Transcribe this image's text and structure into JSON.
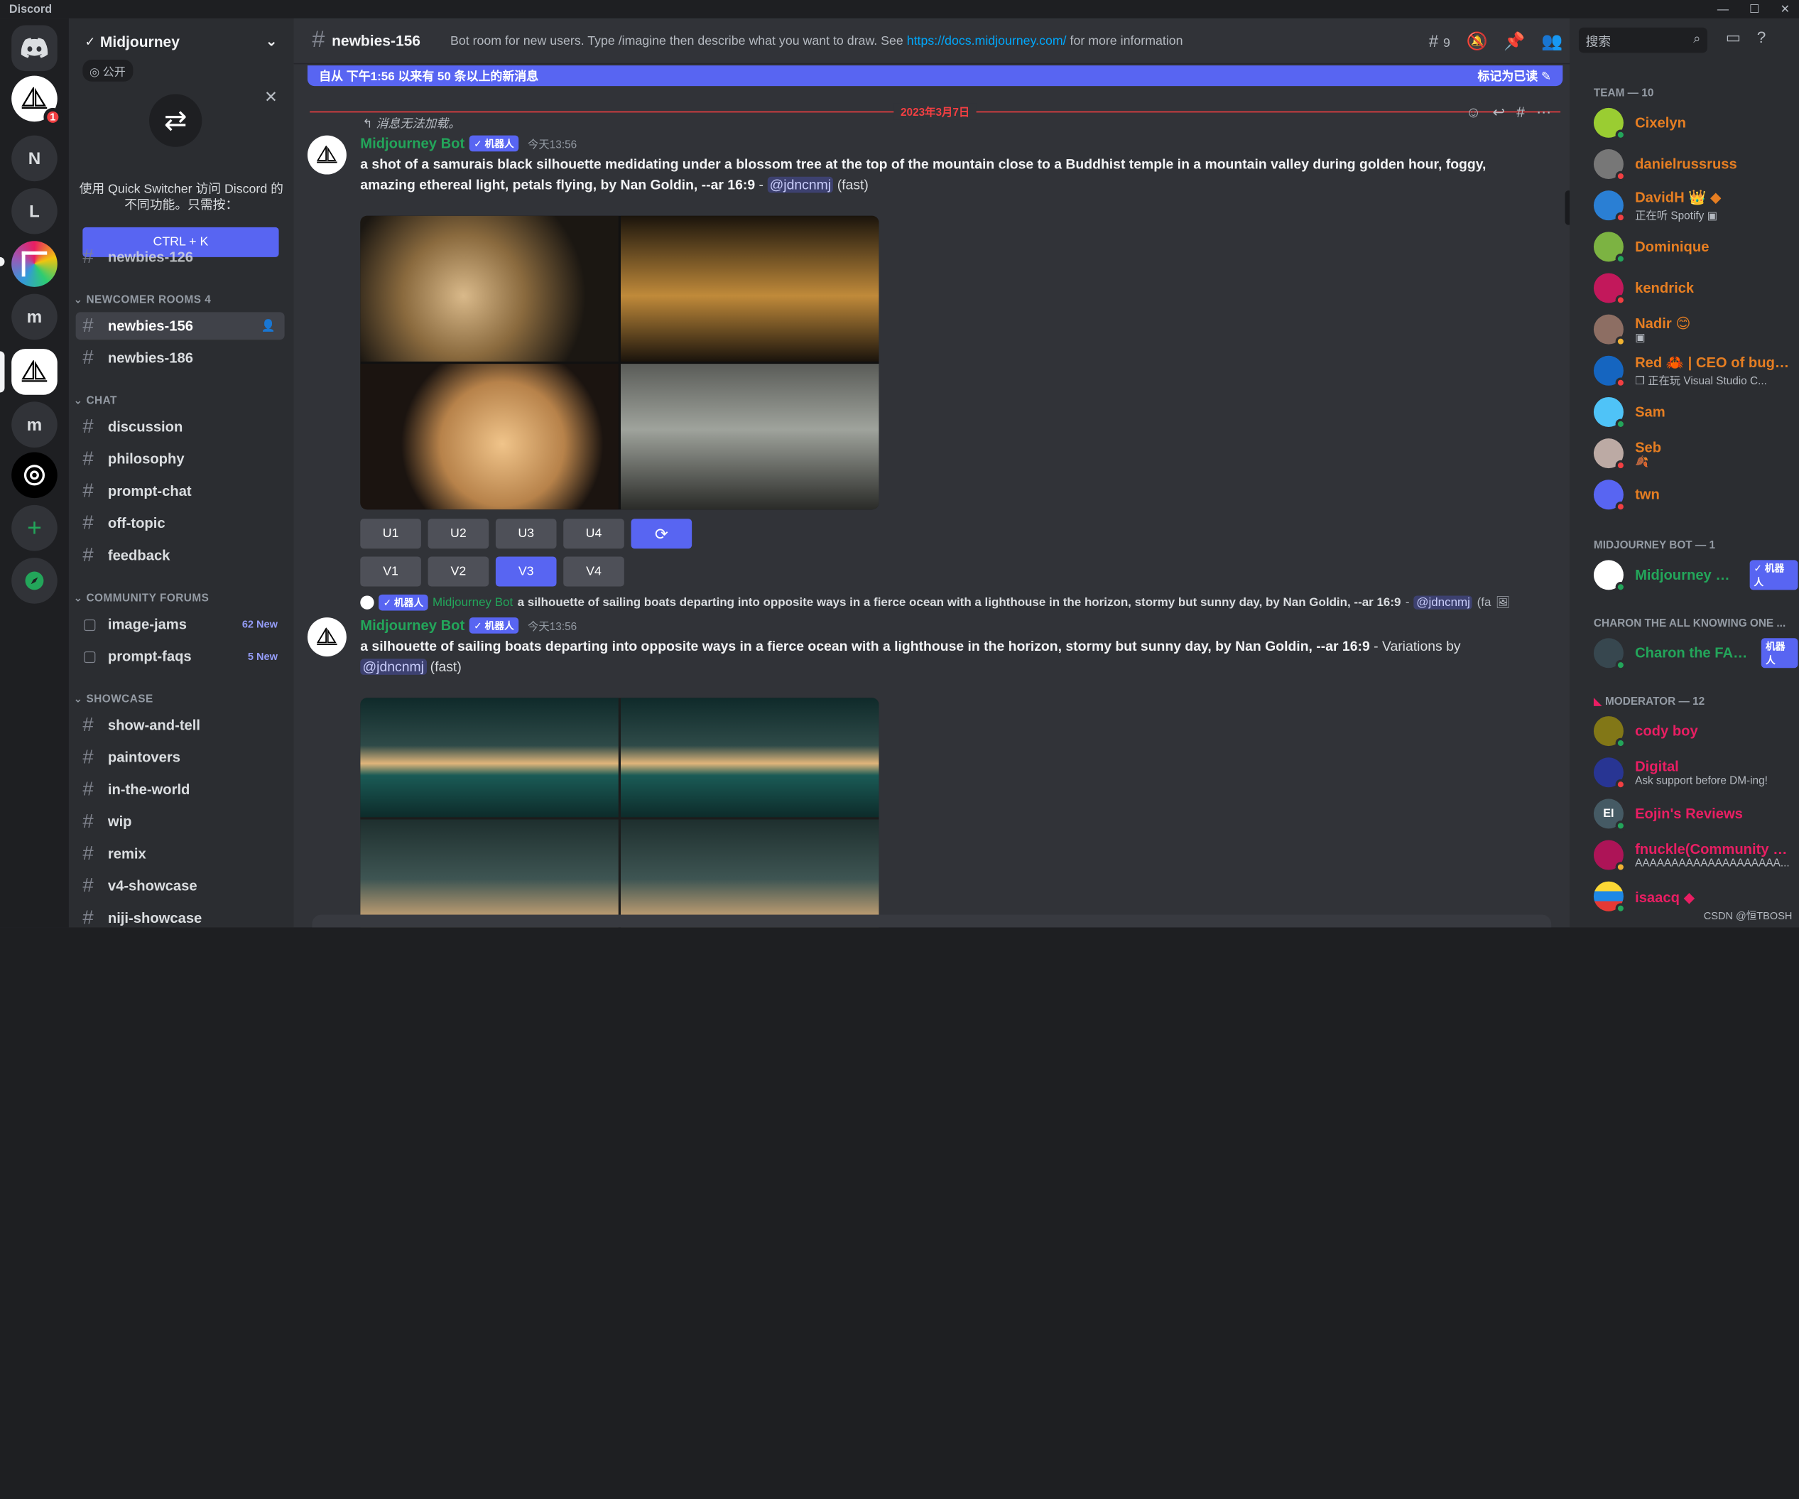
{
  "app_title": "Discord",
  "window_controls": [
    "—",
    "☐",
    "✕"
  ],
  "servers": [
    {
      "label": "N"
    },
    {
      "label": "L"
    },
    {
      "label": "m"
    },
    {
      "label": "m"
    }
  ],
  "server_badge": "1",
  "guild": {
    "name": "Midjourney",
    "public_label": "公开"
  },
  "quick_switcher": {
    "text": "使用 Quick Switcher 访问 Discord 的不同功能。只需按：",
    "button": "CTRL + K"
  },
  "channel_groups": {
    "partial_top": "newbies-126",
    "newcomer": {
      "title": "NEWCOMER ROOMS 4",
      "items": [
        "newbies-156",
        "newbies-186"
      ]
    },
    "chat": {
      "title": "CHAT",
      "items": [
        "discussion",
        "philosophy",
        "prompt-chat",
        "off-topic",
        "feedback"
      ]
    },
    "forums": {
      "title": "COMMUNITY FORUMS",
      "items": [
        {
          "name": "image-jams",
          "new": "62 New"
        },
        {
          "name": "prompt-faqs",
          "new": "5 New"
        }
      ]
    },
    "showcase": {
      "title": "SHOWCASE",
      "items": [
        "show-and-tell",
        "paintovers",
        "in-the-world",
        "wip",
        "remix",
        "v4-showcase",
        "niji-showcase"
      ]
    }
  },
  "header": {
    "channel": "newbies-156",
    "topic_pre": "Bot room for new users. Type /imagine then describe what you want to draw. See ",
    "topic_link": "https://docs.midjourney.com/",
    "topic_post": " for more information",
    "thread_count": "9"
  },
  "new_messages": {
    "text": "自从 下午1:56 以来有 50 条以上的新消息",
    "mark_read": "标记为已读"
  },
  "date_divider": "2023年3月7日",
  "messages": [
    {
      "reply_text": "消息无法加载。",
      "author": "Midjourney Bot",
      "bot_tag": "✓ 机器人",
      "time": "今天13:56",
      "prompt": "a shot of a samurais black silhouette medidating under a blossom tree at the top of the mountain close to a Buddhist temple in a mountain valley during golden hour, foggy, amazing ethereal light, petals flying, by Nan Goldin, --ar 16:9",
      "mention": "@jdncnmj",
      "suffix": "(fast)",
      "upscale_buttons": [
        "U1",
        "U2",
        "U3",
        "U4"
      ],
      "variation_buttons": [
        "V1",
        "V2",
        "V3",
        "V4"
      ]
    },
    {
      "reply_author": "Midjourney Bot",
      "reply_tag": "✓ 机器人",
      "reply_text": "a silhouette of sailing boats departing into opposite ways in a fierce ocean with a lighthouse in the horizon, stormy but sunny day, by Nan Goldin, --ar 16:9",
      "reply_mention": "@jdncnmj",
      "reply_tail": "(fa",
      "author": "Midjourney Bot",
      "bot_tag": "✓ 机器人",
      "time": "今天13:56",
      "prompt": "a silhouette of sailing boats departing into opposite ways in a fierce ocean with a lighthouse in the horizon, stormy but sunny day, by Nan Goldin, --ar 16:9",
      "variations_by": " - Variations by",
      "mention": "@jdncnmj",
      "suffix": "(fast)"
    }
  ],
  "search_placeholder": "搜索",
  "members": {
    "team_title": "TEAM — 10",
    "team": [
      {
        "name": "Cixelyn",
        "color": "#e67e22",
        "status": "#23a55a"
      },
      {
        "name": "danielrussruss",
        "color": "#e67e22",
        "status": "#f23f42"
      },
      {
        "name": "DavidH 👑 ◆",
        "sub": "正在听 Spotify ▣",
        "color": "#e67e22",
        "status": "#f23f42"
      },
      {
        "name": "Dominique",
        "color": "#e67e22",
        "status": "#23a55a"
      },
      {
        "name": "kendrick",
        "color": "#e67e22",
        "status": "#f23f42"
      },
      {
        "name": "Nadir 😊",
        "sub": "▣",
        "color": "#e67e22",
        "status": "#f0b232"
      },
      {
        "name": "Red 🦀 | CEO of bugs ...",
        "sub": "❒ 正在玩 Visual Studio C...",
        "color": "#e67e22",
        "status": "#f23f42"
      },
      {
        "name": "Sam",
        "color": "#e67e22",
        "status": "#23a55a"
      },
      {
        "name": "Seb",
        "sub": "🍂",
        "color": "#e67e22",
        "status": "#f23f42"
      },
      {
        "name": "twn",
        "color": "#e67e22",
        "status": "#f23f42"
      }
    ],
    "bot_title": "MIDJOURNEY BOT — 1",
    "bot": {
      "name": "Midjourney Bot",
      "tag": "✓ 机器人"
    },
    "charon_title": "CHARON THE ALL KNOWING ONE ...",
    "charon": {
      "name": "Charon the FAQ...",
      "tag": "机器人"
    },
    "mod_title": "MODERATOR — 12",
    "mods": [
      {
        "name": "cody boy",
        "color": "#e91e63",
        "status": "#23a55a"
      },
      {
        "name": "Digital",
        "sub": "Ask support before DM-ing!",
        "color": "#e91e63",
        "status": "#f23f42"
      },
      {
        "name": "Eojin's Reviews",
        "color": "#e91e63",
        "status": "#23a55a",
        "initials": "EI"
      },
      {
        "name": "fnuckle(Community Li...",
        "sub": "AAAAAAAAAAAAAAAAAAAA...",
        "color": "#e91e63",
        "status": "#f0b232"
      },
      {
        "name": "isaacq ◆",
        "color": "#e91e63",
        "status": "#23a55a"
      }
    ]
  },
  "watermark": "CSDN @恒TBOSH"
}
